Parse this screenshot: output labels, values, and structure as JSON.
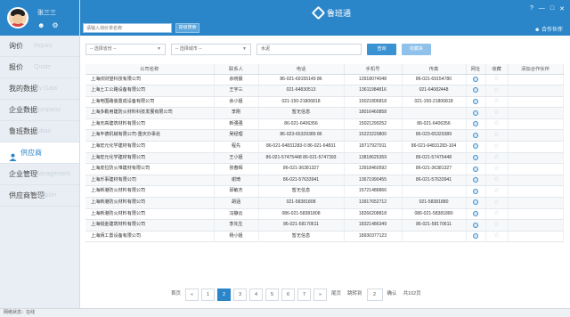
{
  "user": {
    "name": "张三三"
  },
  "sidebar": {
    "items": [
      {
        "label": "询价",
        "en": "Inquiry"
      },
      {
        "label": "报价",
        "en": "Quote"
      },
      {
        "label": "我的数据",
        "en": "My Data"
      },
      {
        "label": "企业数据",
        "en": "Company"
      },
      {
        "label": "鲁班数据",
        "en": "Luban"
      },
      {
        "label": "供应商",
        "en": ""
      },
      {
        "label": "企业管理",
        "en": "Management"
      },
      {
        "label": "供应商管理",
        "en": "Supplier"
      }
    ]
  },
  "header": {
    "search_placeholder": "请输入询价单名称",
    "adv_search": "高级搜索",
    "brand": "鲁班通",
    "partner_link": "合作伙伴"
  },
  "filters": {
    "province": "-- 选择省份 --",
    "city": "-- 选择城市 --",
    "keyword": "水泥",
    "query_btn": "查询",
    "clear_btn": "收藏夹"
  },
  "table": {
    "headers": [
      "公司名称",
      "联系人",
      "电话",
      "手机号",
      "传真",
      "网址",
      "收藏",
      "添加合作伙伴"
    ],
    "rows": [
      [
        "上海欣财望科技有限公司",
        "余晓晨",
        "86-021-69155149 86",
        "13918074048",
        "86-021-69154780"
      ],
      [
        "上海土工公路设备有限公司",
        "王宇三",
        "021-64830513",
        "13611984816",
        "021-64082448"
      ],
      [
        "上海电围路装置成设备有限公司",
        "余小姐",
        "021-150-21806818",
        "15021806818",
        "021-150-21806818"
      ],
      [
        "上海多勒用建防火材料科技发展有限公司",
        "李刚",
        "暂无信息",
        "18016460858",
        ""
      ],
      [
        "上海天高建筑材料有限公司",
        "新强强",
        "86-021-6406356",
        "15021299252",
        "86-021-6406356"
      ],
      [
        "上海丰德机械有限公司-重庆办事处",
        "吴经理",
        "86-023-65329389 86",
        "15223229800",
        "86-023-65329389"
      ],
      [
        "上海宏元化学建材有限公司",
        "程先",
        "86-021-64831283-0 86-021-64831",
        "18717927911",
        "86-021-64831283-104"
      ],
      [
        "上海宏元化学建材有限公司",
        "王小姐",
        "86-021-57475448 86-021-5747393",
        "13818625359",
        "86-021-57475448"
      ],
      [
        "上海皮拉防火堆建材有限公司",
        "张春辉",
        "86-021-36381327",
        "13918460592",
        "86-021-36381327"
      ],
      [
        "上海乐事建材有限公司",
        "谢琦",
        "86-021-57633941",
        "13671990455",
        "86-021-57633941"
      ],
      [
        "上海新港防火材料有限公司",
        "邱敏杰",
        "暂无信息",
        "15721488866",
        ""
      ],
      [
        "上海新港防火材料有限公司",
        "胡涵",
        "021-58381808",
        "13917652712",
        "021-58381880"
      ],
      [
        "上海新港防火材料有限公司",
        "冯静云",
        "086-021-58381808",
        "18266208818",
        "086-021-58381880"
      ],
      [
        "上海锐金建筑材料有限公司",
        "李先生",
        "86-021-58170611",
        "18321486349",
        "86-021-58170611"
      ],
      [
        "上海炳工置设备有限公司",
        "杨小姐",
        "暂无信息",
        "18930377123",
        ""
      ]
    ]
  },
  "pager": {
    "first": "首页",
    "prev": "«",
    "pages": [
      "1",
      "2",
      "3",
      "4",
      "5",
      "6",
      "7"
    ],
    "current": "2",
    "next": "»",
    "last": "尾页",
    "goto": "跳转到",
    "goto_value": "2",
    "ok": "确认",
    "total": "共102页"
  },
  "status": {
    "text": "网络状态：在线"
  }
}
